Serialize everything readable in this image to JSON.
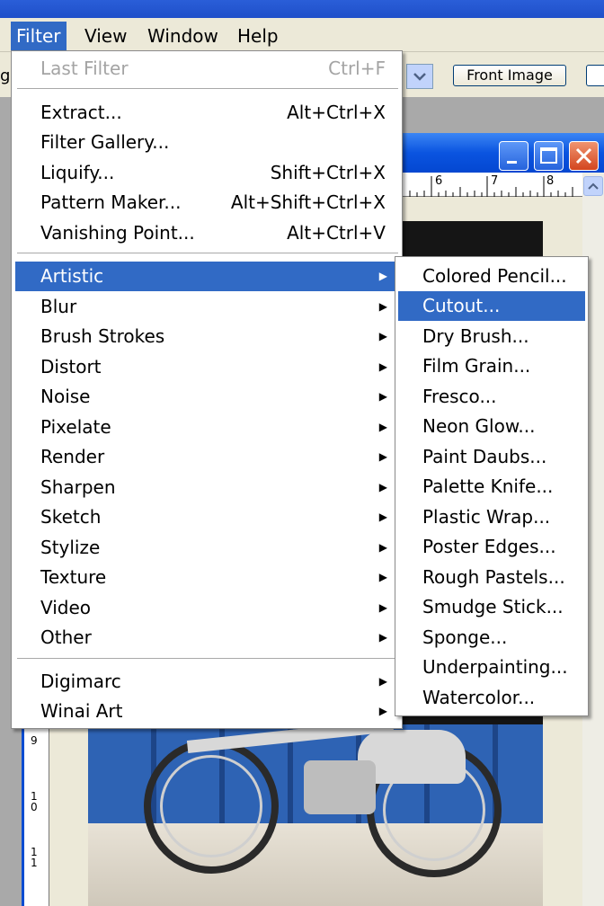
{
  "menubar": {
    "items": [
      {
        "label": "Filter"
      },
      {
        "label": "View"
      },
      {
        "label": "Window"
      },
      {
        "label": "Help"
      }
    ]
  },
  "options_bar": {
    "left_text": "gh",
    "front_image_label": "Front Image"
  },
  "ruler": {
    "top_numbers": [
      "6",
      "7",
      "8"
    ],
    "left_numbers": [
      "9",
      "1\n0",
      "1\n1"
    ]
  },
  "filter_menu": {
    "last_filter": {
      "label": "Last Filter",
      "shortcut": "Ctrl+F"
    },
    "group1": [
      {
        "label": "Extract...",
        "shortcut": "Alt+Ctrl+X"
      },
      {
        "label": "Filter Gallery...",
        "shortcut": ""
      },
      {
        "label": "Liquify...",
        "shortcut": "Shift+Ctrl+X"
      },
      {
        "label": "Pattern Maker...",
        "shortcut": "Alt+Shift+Ctrl+X"
      },
      {
        "label": "Vanishing Point...",
        "shortcut": "Alt+Ctrl+V"
      }
    ],
    "group2": [
      {
        "label": "Artistic"
      },
      {
        "label": "Blur"
      },
      {
        "label": "Brush Strokes"
      },
      {
        "label": "Distort"
      },
      {
        "label": "Noise"
      },
      {
        "label": "Pixelate"
      },
      {
        "label": "Render"
      },
      {
        "label": "Sharpen"
      },
      {
        "label": "Sketch"
      },
      {
        "label": "Stylize"
      },
      {
        "label": "Texture"
      },
      {
        "label": "Video"
      },
      {
        "label": "Other"
      }
    ],
    "group3": [
      {
        "label": "Digimarc"
      },
      {
        "label": "Winai Art"
      }
    ]
  },
  "artistic_submenu": {
    "items": [
      {
        "label": "Colored Pencil..."
      },
      {
        "label": "Cutout..."
      },
      {
        "label": "Dry Brush..."
      },
      {
        "label": "Film Grain..."
      },
      {
        "label": "Fresco..."
      },
      {
        "label": "Neon Glow..."
      },
      {
        "label": "Paint Daubs..."
      },
      {
        "label": "Palette Knife..."
      },
      {
        "label": "Plastic Wrap..."
      },
      {
        "label": "Poster Edges..."
      },
      {
        "label": "Rough Pastels..."
      },
      {
        "label": "Smudge Stick..."
      },
      {
        "label": "Sponge..."
      },
      {
        "label": "Underpainting..."
      },
      {
        "label": "Watercolor..."
      }
    ]
  },
  "colors": {
    "highlight": "#316ac5",
    "menu_bg": "#ffffff",
    "chrome": "#ece9d8",
    "xp_blue": "#0a54e0"
  }
}
